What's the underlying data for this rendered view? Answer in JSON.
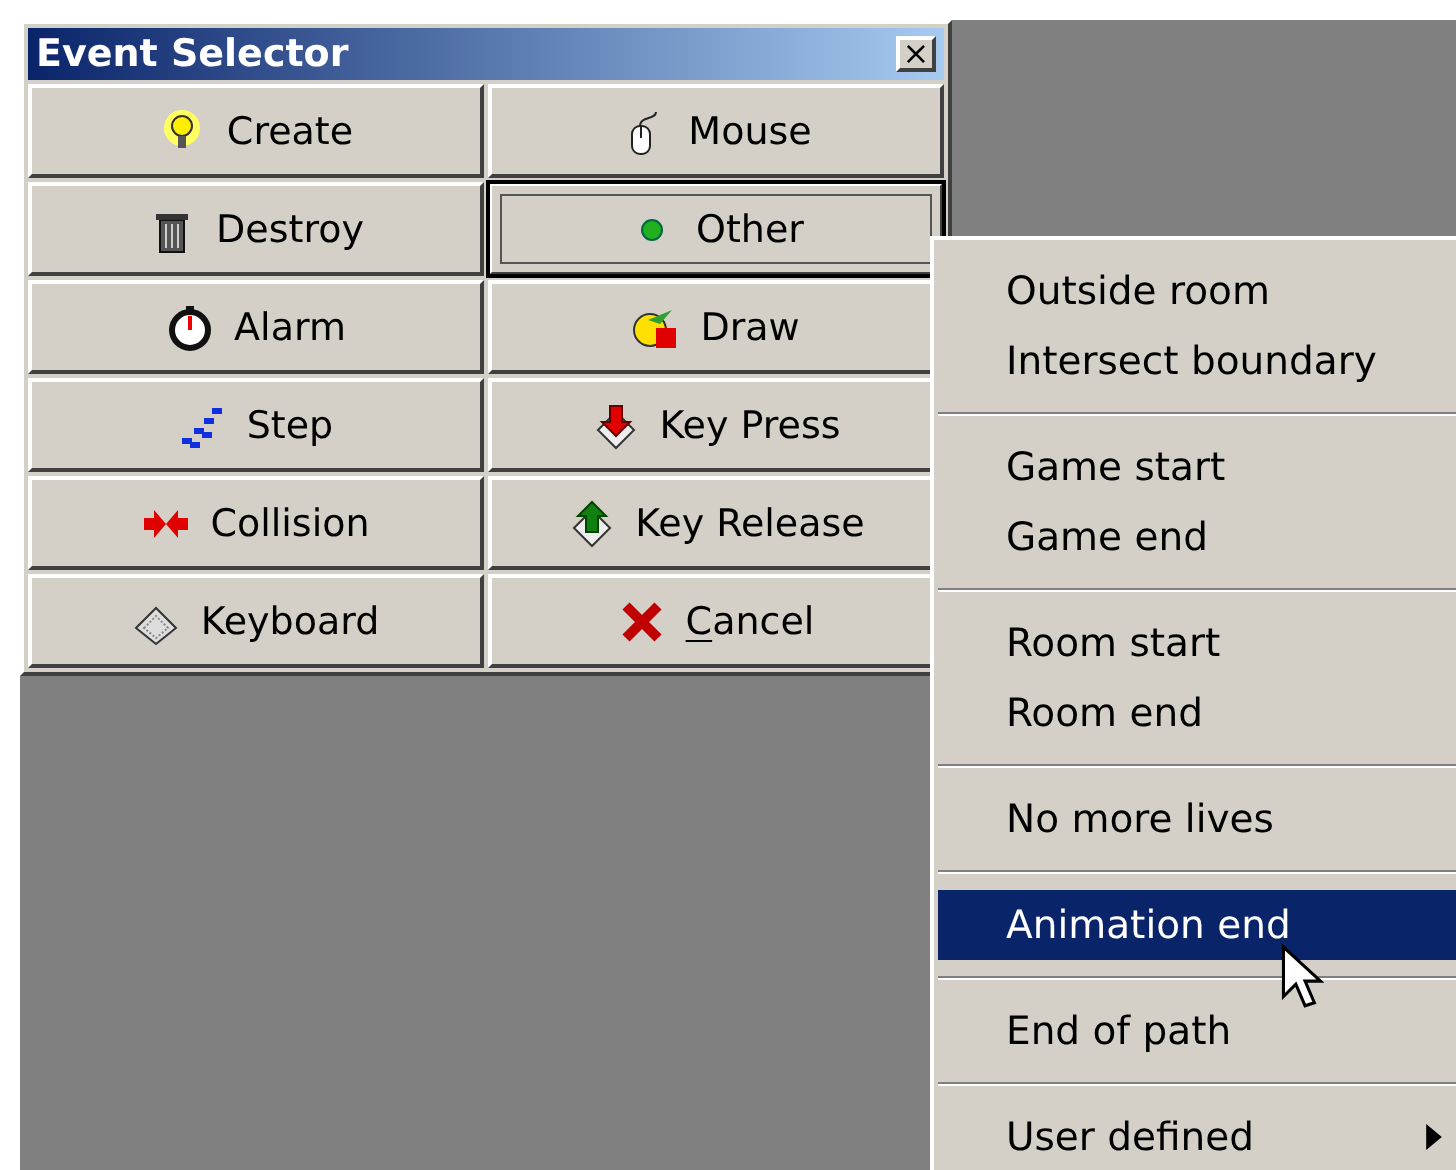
{
  "window": {
    "title": "Event Selector",
    "close": "×"
  },
  "buttons": [
    {
      "label": "Create",
      "focused": false
    },
    {
      "label": "Mouse",
      "focused": false
    },
    {
      "label": "Destroy",
      "focused": false
    },
    {
      "label": "Other",
      "focused": true
    },
    {
      "label": "Alarm",
      "focused": false
    },
    {
      "label": "Draw",
      "focused": false
    },
    {
      "label": "Step",
      "focused": false
    },
    {
      "label": "Key Press",
      "focused": false
    },
    {
      "label": "Collision",
      "focused": false
    },
    {
      "label": "Key Release",
      "focused": false
    },
    {
      "label": "Keyboard",
      "focused": false
    },
    {
      "label": "Cancel",
      "focused": false,
      "first_letter_underlined": true
    }
  ],
  "menu": [
    {
      "kind": "item",
      "label": "Outside room",
      "selected": false
    },
    {
      "kind": "item",
      "label": "Intersect boundary",
      "selected": false
    },
    {
      "kind": "separator"
    },
    {
      "kind": "item",
      "label": "Game start",
      "selected": false
    },
    {
      "kind": "item",
      "label": "Game end",
      "selected": false
    },
    {
      "kind": "separator"
    },
    {
      "kind": "item",
      "label": "Room start",
      "selected": false
    },
    {
      "kind": "item",
      "label": "Room end",
      "selected": false
    },
    {
      "kind": "separator"
    },
    {
      "kind": "item",
      "label": "No more lives",
      "selected": false
    },
    {
      "kind": "separator"
    },
    {
      "kind": "item",
      "label": "Animation end",
      "selected": true
    },
    {
      "kind": "separator"
    },
    {
      "kind": "item",
      "label": "End of path",
      "selected": false
    },
    {
      "kind": "separator"
    },
    {
      "kind": "submenu",
      "label": "User defined",
      "selected": false
    }
  ]
}
